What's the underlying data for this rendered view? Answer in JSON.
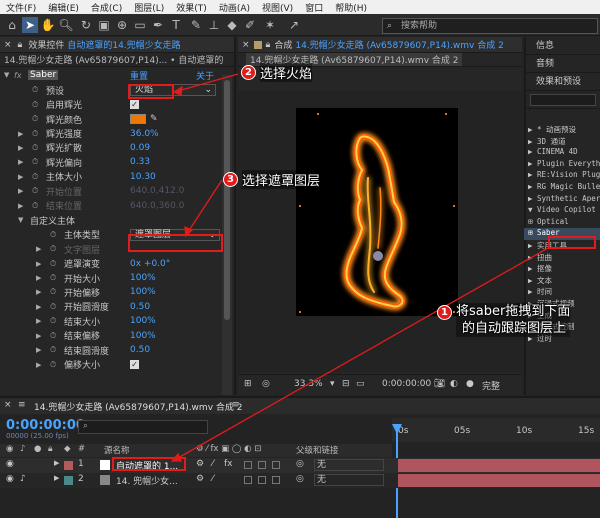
{
  "menubar": {
    "items": [
      "文件(F)",
      "编辑(E)",
      "合成(C)",
      "图层(L)",
      "效果(T)",
      "动画(A)",
      "视图(V)",
      "窗口",
      "帮助(H)"
    ]
  },
  "toolbar": {
    "search_placeholder": "搜索帮助"
  },
  "effect_controls": {
    "tab_prefix": "效果控件",
    "tab_layer": "自动遮罩的14.兜帽少女走路",
    "subheader": "14.兜帽少女走路 (Av65879607,P14)... • 自动遮罩的",
    "effect_name": "Saber",
    "effect_reset": "重置",
    "effect_about": "关于",
    "properties": [
      {
        "name": "预设",
        "value": "火焰",
        "kind": "dropdown"
      },
      {
        "name": "启用辉光",
        "value": "",
        "kind": "checkbox"
      },
      {
        "name": "辉光颜色",
        "value": "",
        "kind": "color"
      },
      {
        "name": "辉光强度",
        "value": "36.0%"
      },
      {
        "name": "辉光扩散",
        "value": "0.09"
      },
      {
        "name": "辉光偏向",
        "value": "0.33"
      },
      {
        "name": "主体大小",
        "value": "10.30"
      },
      {
        "name": "开始位置",
        "value": "640.0,412.0",
        "dim": true
      },
      {
        "name": "结束位置",
        "value": "640.0,360.0",
        "dim": true
      },
      {
        "name": "自定义主体",
        "value": "",
        "group": true
      },
      {
        "name": "主体类型",
        "value": "遮罩图层",
        "kind": "dropdown"
      },
      {
        "name": "文字图层",
        "value": "",
        "dim": true
      },
      {
        "name": "遮罩演变",
        "value": "0x +0.0°"
      },
      {
        "name": "开始大小",
        "value": "100%"
      },
      {
        "name": "开始偏移",
        "value": "100%"
      },
      {
        "name": "开始圆滑度",
        "value": "0.50"
      },
      {
        "name": "结束大小",
        "value": "100%"
      },
      {
        "name": "结束偏移",
        "value": "100%"
      },
      {
        "name": "结束圆滑度",
        "value": "0.50"
      },
      {
        "name": "偏移大小",
        "value": ""
      }
    ]
  },
  "composition": {
    "tab_prefix": "合成",
    "tab_name": "14.兜帽少女走路 (Av65879607,P14).wmv 合成 2",
    "sub_tab": "14.兜帽少女走路 (Av65879607,P14).wmv 合成 2",
    "zoom": "33.3%",
    "timecode": "0:00:00:00",
    "quality": "完整"
  },
  "right_panel": {
    "info": "信息",
    "audio": "音频",
    "effects_presets": "效果和预设",
    "tree": [
      "* 动画预设",
      "3D 通道",
      "CINEMA 4D",
      "Plugin Everyth",
      "RE:Vision Plug",
      "RG Magic Bulle",
      "Synthetic Aper",
      "Video Copilot",
      "Optical",
      "Saber",
      "实用工具",
      "扭曲",
      "抠像",
      "文本",
      "时间",
      "沉浸式视频",
      "生成",
      "表达式控制",
      "过时"
    ]
  },
  "timeline": {
    "tab": "14.兜帽少女走路 (Av65879607,P14).wmv 合成 2",
    "timecode": "0:00:00:00",
    "fps": "00000 (25.00 fps)",
    "col_source": "源名称",
    "col_parent": "父级和链接",
    "ruler": [
      "0s",
      "05s",
      "10s",
      "15s"
    ],
    "layers": [
      {
        "index": "1",
        "name": "自动遮罩的 1...",
        "parent": "无",
        "color": "#b55a5a"
      },
      {
        "index": "2",
        "name": "14. 兜帽少女...",
        "parent": "无",
        "color": "#4b8a8a"
      }
    ]
  },
  "annotations": {
    "step1_num": "1",
    "step1_text_a": "将saber拖拽到下面",
    "step1_text_b": "的自动跟踪图层上",
    "step2_num": "2",
    "step2_text": "选择火焰",
    "step3_num": "3",
    "step3_text": "选择遮罩图层"
  },
  "colors": {
    "accent": "#4aa3ff",
    "annotation": "#e21b1b",
    "glow": "#f07800"
  }
}
